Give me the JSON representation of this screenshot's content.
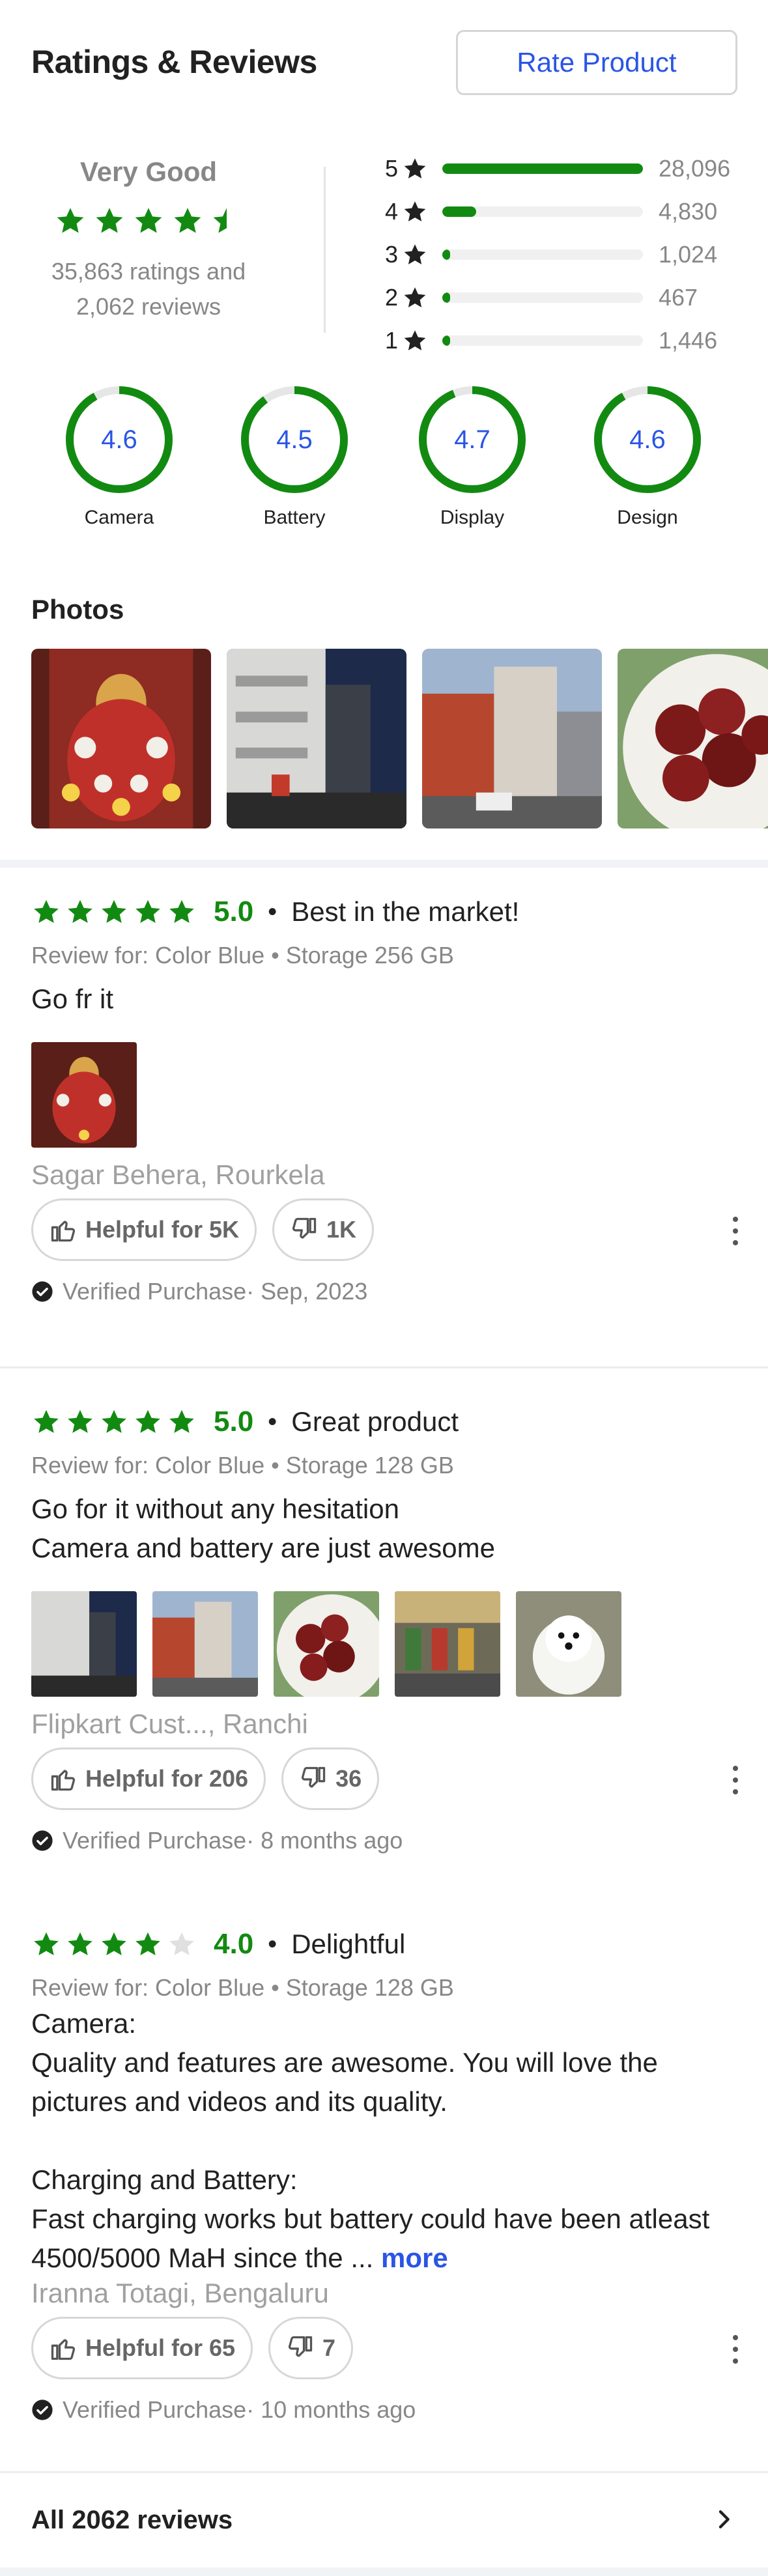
{
  "header": {
    "title": "Ratings & Reviews",
    "rate_button": "Rate Product"
  },
  "summary": {
    "verdict": "Very Good",
    "average_stars": 4.5,
    "count_line1": "35,863 ratings and",
    "count_line2": "2,062 reviews"
  },
  "distribution": [
    {
      "stars": "5",
      "count": "28,096",
      "fraction": 1.0
    },
    {
      "stars": "4",
      "count": "4,830",
      "fraction": 0.17
    },
    {
      "stars": "3",
      "count": "1,024",
      "fraction": 0.04
    },
    {
      "stars": "2",
      "count": "467",
      "fraction": 0.04
    },
    {
      "stars": "1",
      "count": "1,446",
      "fraction": 0.04
    }
  ],
  "aspects": [
    {
      "label": "Camera",
      "value": "4.6",
      "fraction": 0.92
    },
    {
      "label": "Battery",
      "value": "4.5",
      "fraction": 0.9
    },
    {
      "label": "Display",
      "value": "4.7",
      "fraction": 0.94
    },
    {
      "label": "Design",
      "value": "4.6",
      "fraction": 0.92
    }
  ],
  "photos": {
    "title": "Photos"
  },
  "reviews": [
    {
      "rating": 5,
      "score": "5.0",
      "title": "Best in the market!",
      "variant": "Review for: Color Blue • Storage 256 GB",
      "body": "Go fr it",
      "more": "",
      "author": "Sagar Behera, Rourkela",
      "helpful": "Helpful for 5K",
      "dislikes": "1K",
      "verified": "Verified Purchase· Sep, 2023"
    },
    {
      "rating": 5,
      "score": "5.0",
      "title": "Great product",
      "variant": "Review for: Color Blue • Storage 128 GB",
      "body": "Go for it without any hesitation\nCamera and battery are just awesome",
      "more": "",
      "author": "Flipkart Cust..., Ranchi",
      "helpful": "Helpful for 206",
      "dislikes": "36",
      "verified": "Verified Purchase· 8 months ago"
    },
    {
      "rating": 4,
      "score": "4.0",
      "title": "Delightful",
      "variant": "Review for: Color Blue • Storage 128 GB",
      "body": "Camera:\nQuality and features are awesome. You will love the pictures and videos and its quality.\n\nCharging and Battery:\nFast charging works but battery could have been atleast 4500/5000 MaH since the ...",
      "more": "more",
      "author": "Iranna Totagi, Bengaluru",
      "helpful": "Helpful for 65",
      "dislikes": "7",
      "verified": "Verified Purchase· 10 months ago"
    }
  ],
  "footer": {
    "all_reviews": "All 2062 reviews"
  },
  "colors": {
    "green": "#128a11",
    "blue": "#2a55e5",
    "grey_text": "#878787"
  },
  "icons": [
    "star-icon",
    "thumbs-up-icon",
    "thumbs-down-icon",
    "more-vertical-icon",
    "verified-check-icon",
    "chevron-right-icon"
  ]
}
